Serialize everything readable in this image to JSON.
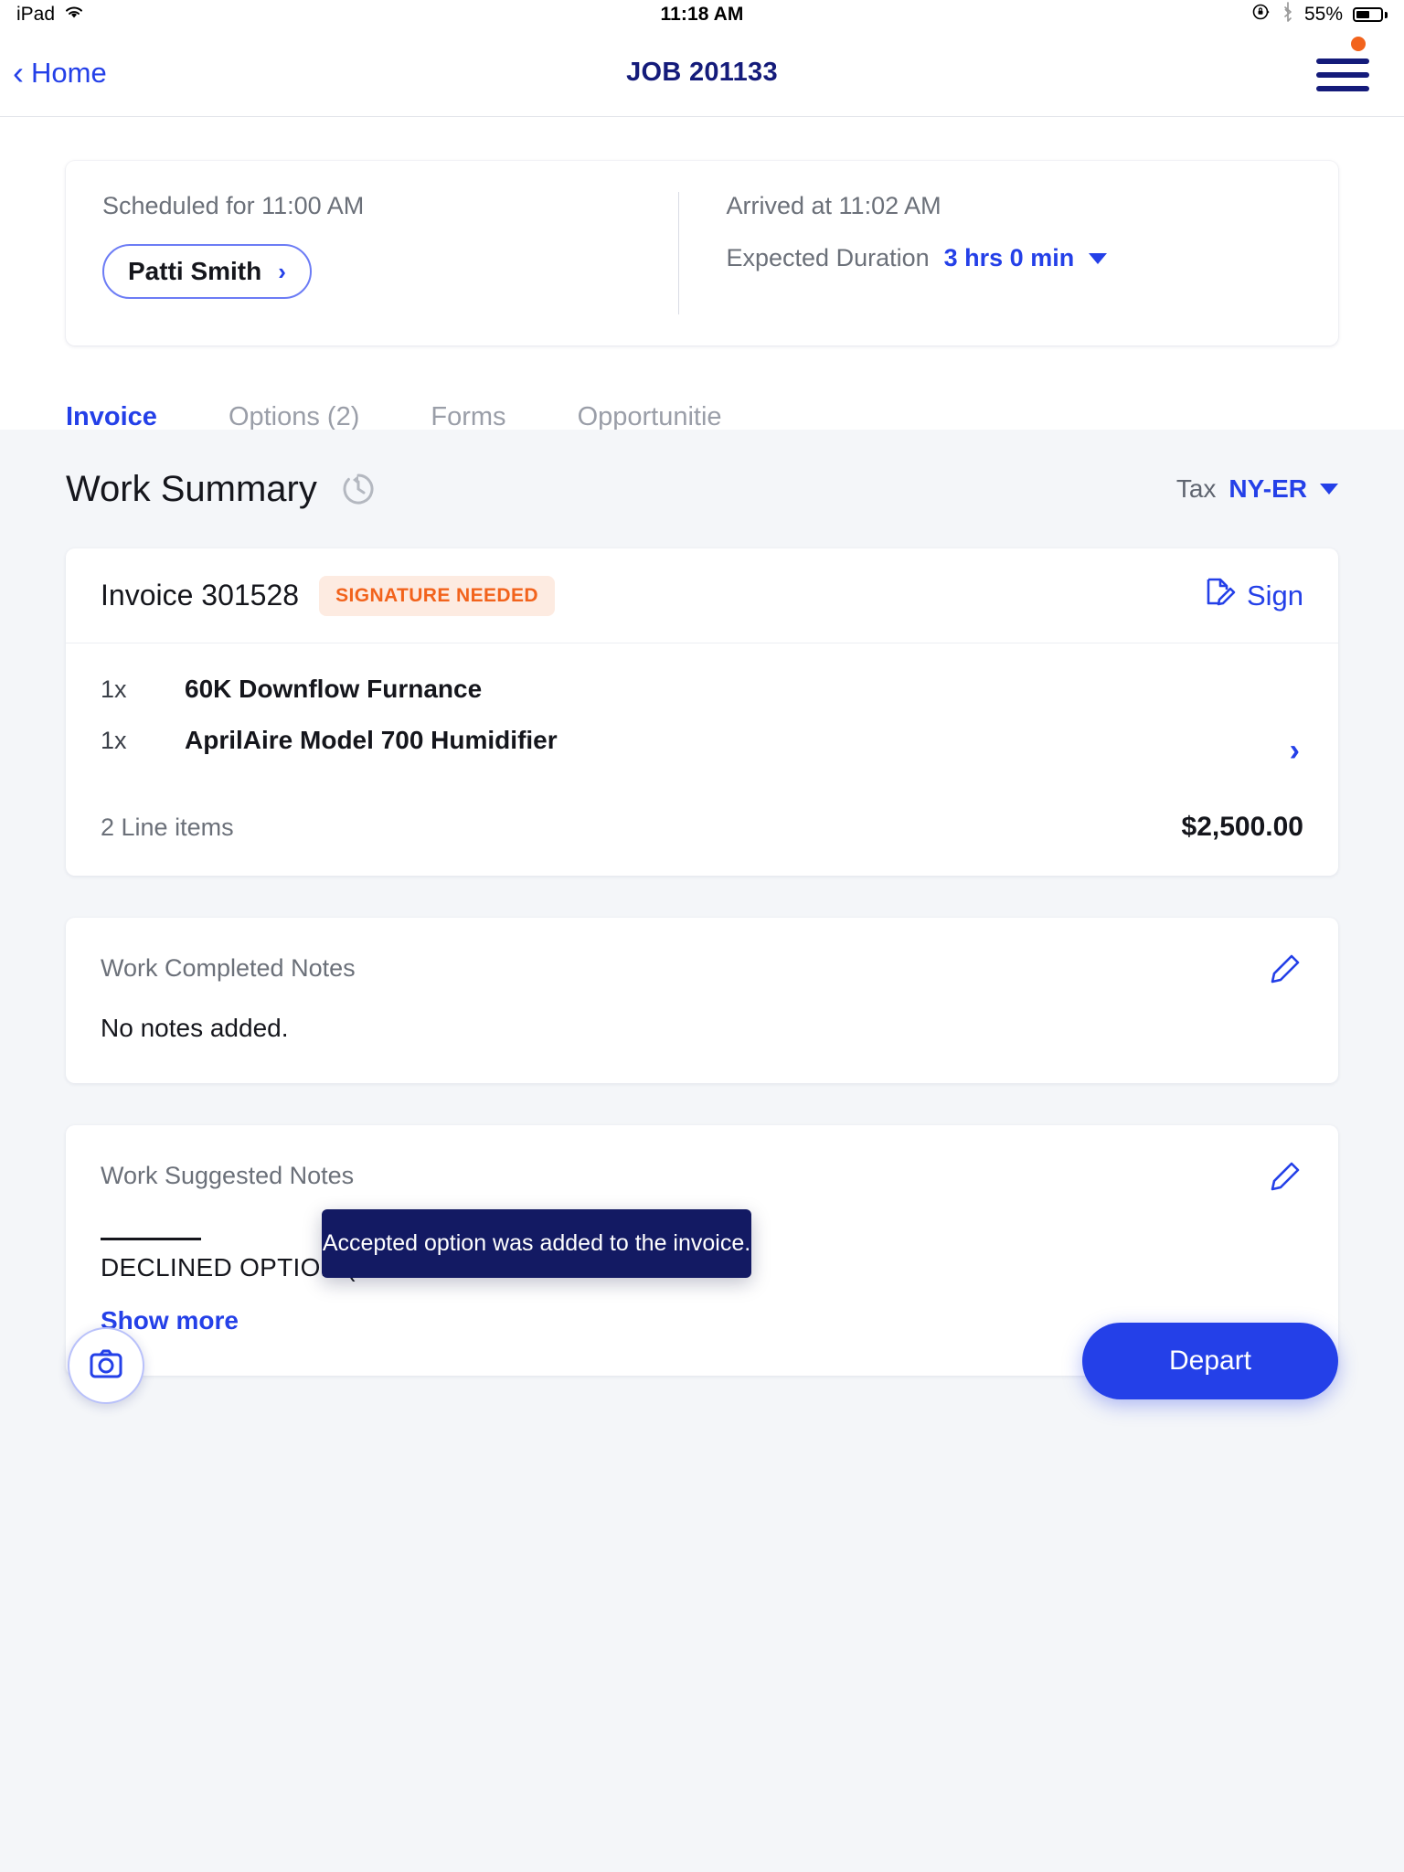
{
  "status_bar": {
    "device": "iPad",
    "wifi_icon": "wifi-icon",
    "time": "11:18 AM",
    "rotation_lock_icon": "rotation-lock-icon",
    "bluetooth_icon": "bluetooth-icon",
    "battery_percent": "55%",
    "battery_level": 55
  },
  "nav": {
    "back_label": "Home",
    "back_icon": "chevron-left-icon",
    "title": "JOB 201133",
    "menu_icon": "hamburger-menu-icon",
    "notification_dot": true
  },
  "job_card": {
    "scheduled": "Scheduled for 11:00 AM",
    "technician": "Patti Smith",
    "technician_arrow_icon": "chevron-right-icon",
    "arrived": "Arrived at 11:02 AM",
    "duration_label": "Expected Duration",
    "duration_value": "3 hrs 0 min",
    "duration_caret_icon": "chevron-down-icon"
  },
  "tabs": [
    {
      "label": "Invoice",
      "active": true
    },
    {
      "label": "Options (2)",
      "active": false
    },
    {
      "label": "Forms",
      "active": false
    },
    {
      "label": "Opportunitie",
      "active": false
    }
  ],
  "work_summary": {
    "title": "Work Summary",
    "refresh_icon": "refresh-icon",
    "tax_label": "Tax",
    "tax_value": "NY-ER",
    "tax_caret_icon": "chevron-down-icon"
  },
  "invoice": {
    "title": "Invoice 301528",
    "badge": "SIGNATURE NEEDED",
    "sign_label": "Sign",
    "sign_icon": "document-sign-icon",
    "chevron_icon": "chevron-right-icon",
    "line_items": [
      {
        "qty": "1x",
        "name": "60K Downflow Furnance"
      },
      {
        "qty": "1x",
        "name": "AprilAire Model 700 Humidifier"
      }
    ],
    "footer_left": "2 Line items",
    "footer_right": "$2,500.00"
  },
  "work_completed_notes": {
    "label": "Work Completed Notes",
    "body": "No notes added.",
    "edit_icon": "pencil-icon"
  },
  "work_suggested_notes": {
    "label": "Work Suggested Notes",
    "body": "DECLINED OPTION (R",
    "show_more": "Show more",
    "edit_icon": "pencil-icon"
  },
  "toast": {
    "message": "Accepted option was added to the invoice."
  },
  "actions": {
    "camera_icon": "camera-icon",
    "depart_label": "Depart"
  },
  "colors": {
    "accent_blue": "#2440e8",
    "nav_navy": "#141b7a",
    "badge_orange": "#f2631c",
    "badge_bg": "#fdebe1",
    "toast_navy": "#131a63",
    "page_bg": "#f4f6f9"
  }
}
